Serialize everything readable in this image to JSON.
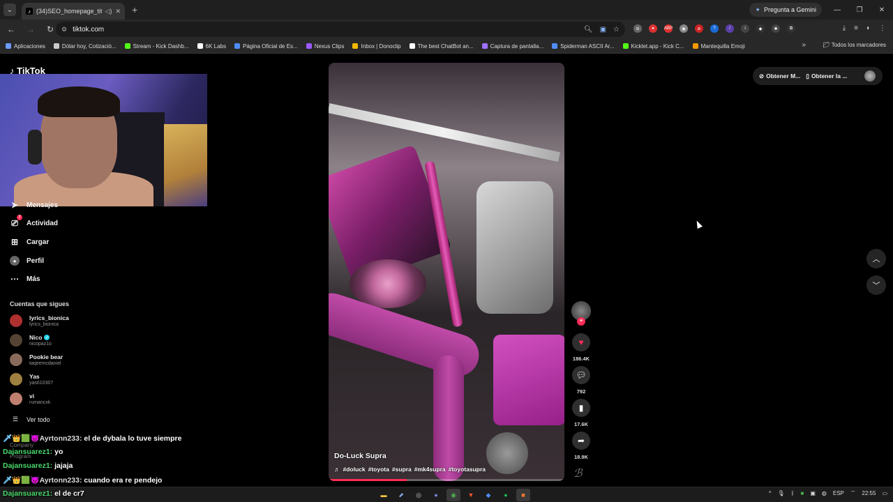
{
  "browser": {
    "tab_title": "(34)SEO_homepage_title",
    "tab_icon": "tiktok-icon",
    "gemini_label": "Pregunta a Gemini",
    "url": "tiktok.com",
    "bookmarks": [
      "Aplicaciones",
      "Dólar hoy, Cotizació...",
      "Stream - Kick Dashb...",
      "6K Labs",
      "Página Oficial de Es...",
      "Nexus Clips",
      "Inbox | Donoclip",
      "The best ChatBot an...",
      "Captura de pantalla...",
      "Spiderman ASCII Ar...",
      "Kicklet.app - Kick C...",
      "Mantequilla Emoji"
    ],
    "bookmarks_all": "Todos los marcadores",
    "bookmark_colors": [
      "#6b9cff",
      "#cccccc",
      "#53fc18",
      "#ffffff",
      "#4f8df5",
      "#9b59ff",
      "#f5b800",
      "#ffffff",
      "#a070ff",
      "#4f8df5",
      "#53fc18",
      "#f59b00"
    ]
  },
  "tiktok": {
    "logo": "TikTok",
    "nav": [
      {
        "label": "Mensajes",
        "icon": "send-icon"
      },
      {
        "label": "Actividad",
        "icon": "inbox-icon",
        "badge": "7"
      },
      {
        "label": "Cargar",
        "icon": "upload-icon"
      },
      {
        "label": "Perfil",
        "icon": "profile-icon"
      },
      {
        "label": "Más",
        "icon": "more-icon"
      }
    ],
    "following_title": "Cuentas que sigues",
    "following": [
      {
        "name": "lyrics_bionica",
        "handle": "lyrics_bionica",
        "verified": false,
        "color": "#b03030"
      },
      {
        "name": "Nico",
        "handle": "nicopaz1o",
        "verified": true,
        "color": "#554433"
      },
      {
        "name": "Pookie bear",
        "handle": "taqeemcdaniel",
        "verified": false,
        "color": "#8a6a5a"
      },
      {
        "name": "Yas",
        "handle": "yas610307",
        "verified": false,
        "color": "#a08040"
      },
      {
        "name": "vi",
        "handle": "rumancxk",
        "verified": false,
        "color": "#c08070"
      }
    ],
    "see_all": "Ver todo",
    "footer_faint": [
      "Company",
      "Program"
    ],
    "video": {
      "title": "Do-Luck Supra",
      "tags": [
        "#doluck",
        "#toyota",
        "#supra",
        "#mk4supra",
        "#toyotasupra"
      ],
      "progress": 0.33
    },
    "actions": {
      "likes": "186.4K",
      "comments": "792",
      "saves": "17.6K",
      "shares": "18.9K"
    },
    "top_right": {
      "get_coins": "Obtener M...",
      "get_app": "Obtener la ..."
    }
  },
  "chat": [
    {
      "user": "Ayrtonn233",
      "badges": "🗡👑🟩😈",
      "text": "el de dybala lo tuve siempre"
    },
    {
      "user": "Dajansuarez1",
      "badges": "",
      "text": "yo"
    },
    {
      "user": "Dajansuarez1",
      "badges": "",
      "text": "jajaja"
    },
    {
      "user": "Ayrtonn233",
      "badges": "🗡👑🟩😈",
      "text": "cuando era re pendejo"
    },
    {
      "user": "Dajansuarez1",
      "badges": "",
      "text": "el de cr7"
    }
  ],
  "taskbar": {
    "lang": "ESP",
    "time": "22:55"
  }
}
